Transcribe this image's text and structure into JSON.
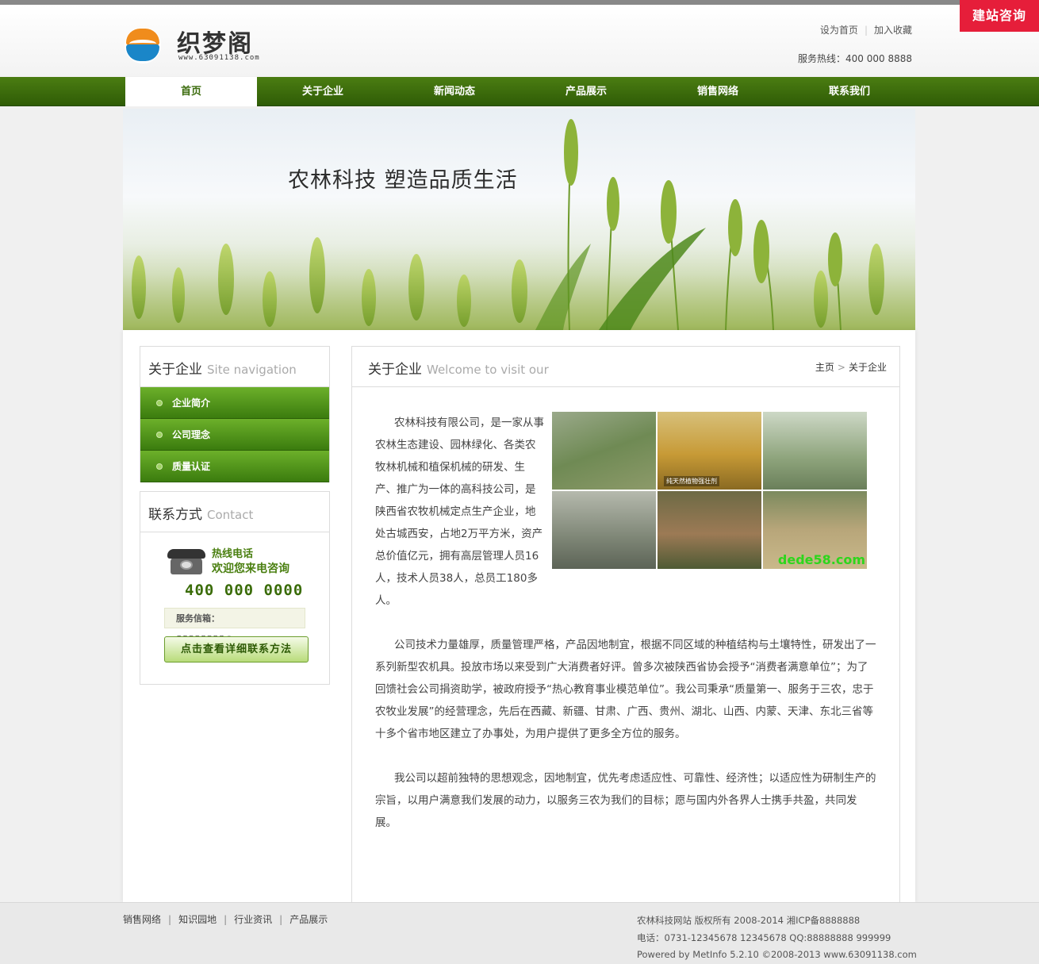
{
  "header": {
    "logo_text": "织梦阁",
    "logo_sub": "www.63091138.com",
    "set_home": "设为首页",
    "bookmark": "加入收藏",
    "hotline": "服务热线：400 000 8888"
  },
  "consult_label": "建站咨询",
  "nav": [
    "首页",
    "关于企业",
    "新闻动态",
    "产品展示",
    "销售网络",
    "联系我们"
  ],
  "banner": {
    "title": "农林科技  塑造品质生活"
  },
  "sidebar": {
    "title": "关于企业",
    "title_en": "Site navigation",
    "items": [
      "企业简介",
      "公司理念",
      "质量认证"
    ]
  },
  "contact": {
    "title": "联系方式",
    "title_en": "Contact",
    "hotline_label": "热线电话",
    "welcome": "欢迎您来电咨询",
    "number": "400 000 0000",
    "mail": "服务信箱：88888888@qq.com",
    "detail_button": "点击查看详细联系方法"
  },
  "content": {
    "title": "关于企业",
    "title_en": "Welcome to visit our",
    "breadcrumb": [
      "主页",
      "关于企业"
    ],
    "intro": "农林科技有限公司，是一家从事农林生态建设、园林绿化、各类农牧林机械和植保机械的研发、生产、推广为一体的高科技公司，是陕西省农牧机械定点生产企业，地处古城西安，占地2万平方米，资产总价值亿元，拥有高层管理人员16人，技术人员38人，总员工180多人。",
    "gallery_caption": "纯天然植物强壮剂",
    "gallery_watermark": "dede58.com",
    "para2": "公司技术力量雄厚，质量管理严格，产品因地制宜，根据不同区域的种植结构与土壤特性，研发出了一系列新型农机具。投放市场以来受到广大消费者好评。曾多次被陕西省协会授予“消费者满意单位”；为了回馈社会公司捐资助学，被政府授予“热心教育事业模范单位”。我公司秉承“质量第一、服务于三农，忠于农牧业发展”的经营理念，先后在西藏、新疆、甘肃、广西、贵州、湖北、山西、内蒙、天津、东北三省等十多个省市地区建立了办事处，为用户提供了更多全方位的服务。",
    "para3": "我公司以超前独特的思想观念，因地制宜，优先考虑适应性、可靠性、经济性；以适应性为研制生产的宗旨，以用户满意我们发展的动力，以服务三农为我们的目标；愿与国内外各界人士携手共盈，共同发展。"
  },
  "footer": {
    "links": [
      "销售网络",
      "知识园地",
      "行业资讯",
      "产品展示"
    ],
    "copyright": "农林科技网站 版权所有 2008-2014 湘ICP备8888888",
    "phone": "电话：0731-12345678 12345678 QQ:88888888 999999",
    "powered": "Powered by MetInfo 5.2.10 ©2008-2013 www.63091138.com"
  },
  "colors": {
    "nav_green": "#3b6b0c",
    "consult_red": "#e61e3a"
  }
}
